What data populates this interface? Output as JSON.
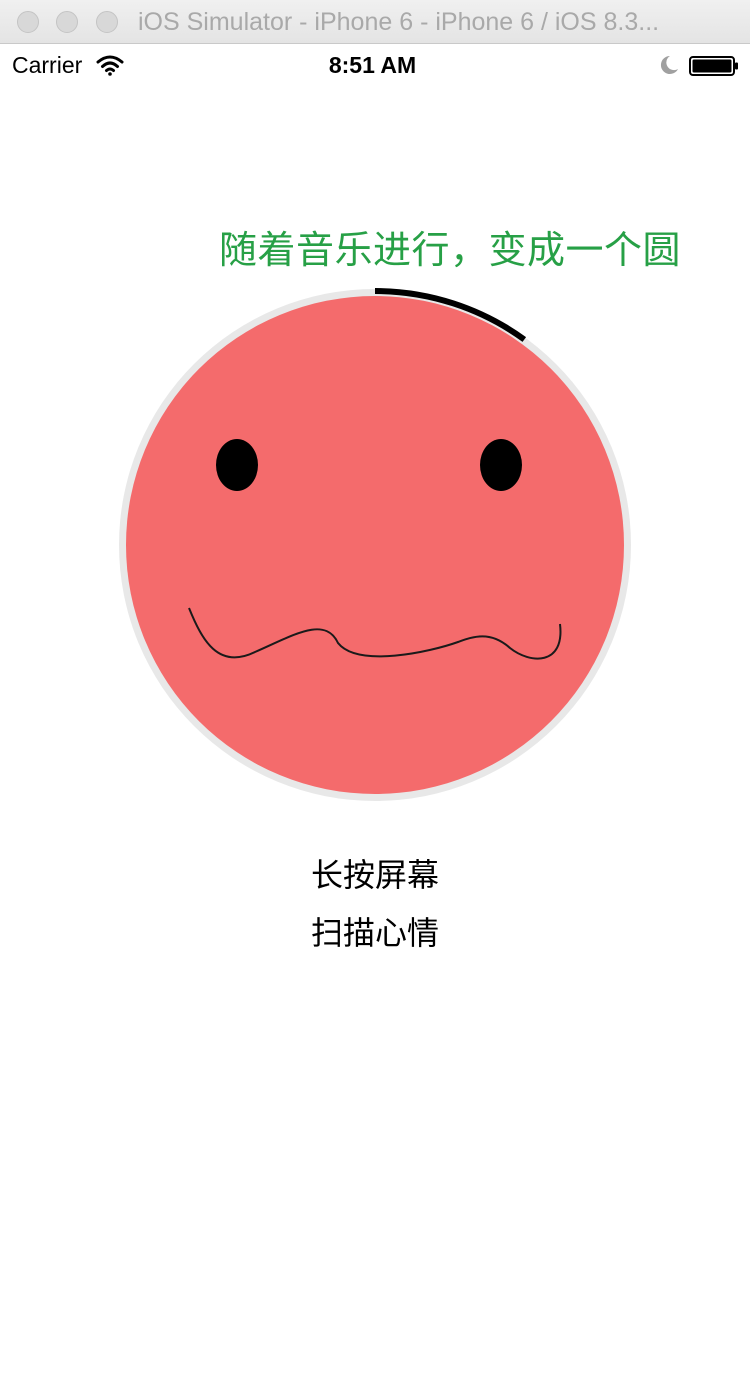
{
  "window": {
    "title": "iOS Simulator - iPhone 6 - iPhone 6 / iOS 8.3..."
  },
  "statusbar": {
    "carrier": "Carrier",
    "time": "8:51 AM",
    "icons": [
      "wifi-icon",
      "moon-icon",
      "battery-icon"
    ]
  },
  "main": {
    "caption": "随着音乐进行，变成一个圆",
    "caption_color": "#27a046",
    "face_color": "#f46b6c",
    "ring_color": "#e8e8e8",
    "progress_color": "#000000",
    "progress": 0.1,
    "hint_line1": "长按屏幕",
    "hint_line2": "扫描心情"
  }
}
